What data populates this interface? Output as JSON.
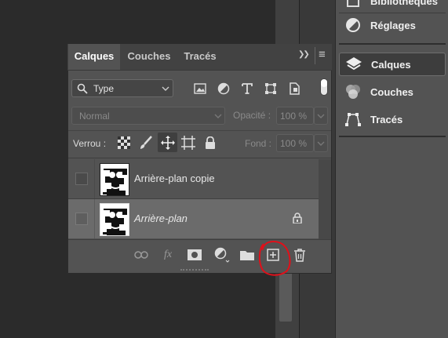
{
  "right_dock": {
    "items": [
      {
        "label": "Bibliothèques",
        "icon": "library-icon"
      },
      {
        "label": "Réglages",
        "icon": "adjustments-icon"
      },
      {
        "label": "Calques",
        "icon": "layers-icon"
      },
      {
        "label": "Couches",
        "icon": "channels-icon"
      },
      {
        "label": "Tracés",
        "icon": "paths-icon"
      }
    ]
  },
  "panel": {
    "tabs": [
      {
        "label": "Calques"
      },
      {
        "label": "Couches"
      },
      {
        "label": "Tracés"
      }
    ],
    "collapse_glyph": "❯❯",
    "menu_glyph": "≡",
    "filter": {
      "value": "Type"
    },
    "blend_mode": {
      "value": "Normal"
    },
    "opacity": {
      "label": "Opacité :",
      "value": "100 %"
    },
    "lock": {
      "label": "Verrou :"
    },
    "fill": {
      "label": "Fond :",
      "value": "100 %"
    },
    "layers": [
      {
        "name": "Arrière-plan copie",
        "locked": false,
        "italic": false
      },
      {
        "name": "Arrière-plan",
        "locked": true,
        "italic": true
      }
    ],
    "bottom_tools": [
      "link-icon",
      "fx-icon",
      "mask-icon",
      "adjustment-layer-icon",
      "folder-icon",
      "new-layer-icon",
      "trash-icon"
    ],
    "fx_label": "fx"
  },
  "colors": {
    "panel_bg": "#535353",
    "selected_row": "#6b6b6b",
    "annotation": "#e0101a"
  }
}
